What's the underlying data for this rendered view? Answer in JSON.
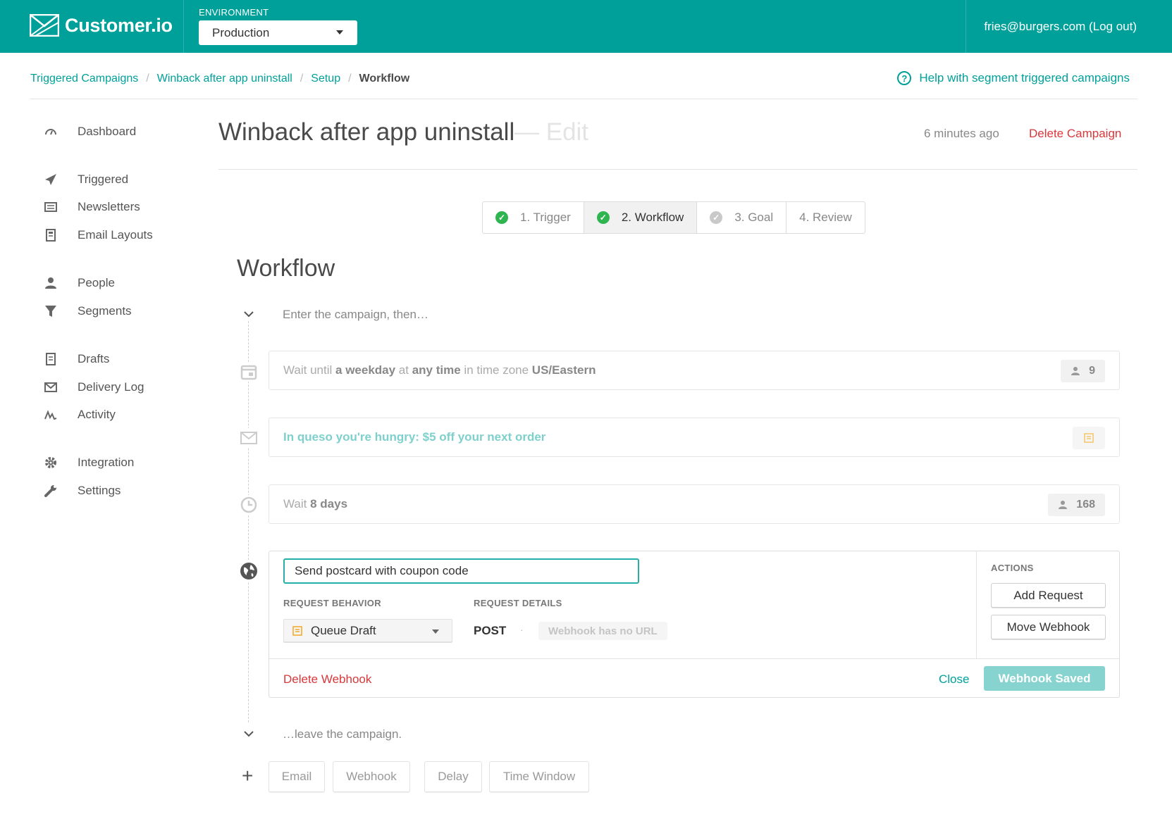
{
  "header": {
    "brand": "Customer.io",
    "environment_label": "ENVIRONMENT",
    "environment_value": "Production",
    "user": "fries@burgers.com (Log out)"
  },
  "breadcrumb": {
    "items": [
      "Triggered Campaigns",
      "Winback after app uninstall",
      "Setup"
    ],
    "current": "Workflow",
    "separator": "/"
  },
  "help": {
    "label": "Help with segment triggered campaigns"
  },
  "sidebar": {
    "items": [
      {
        "label": "Dashboard",
        "icon": "dashboard-icon"
      },
      {
        "label": "Triggered",
        "icon": "paper-plane-icon"
      },
      {
        "label": "Newsletters",
        "icon": "newspaper-icon"
      },
      {
        "label": "Email Layouts",
        "icon": "layout-icon"
      },
      {
        "label": "People",
        "icon": "person-icon"
      },
      {
        "label": "Segments",
        "icon": "funnel-icon"
      },
      {
        "label": "Drafts",
        "icon": "document-icon"
      },
      {
        "label": "Delivery Log",
        "icon": "envelope-icon"
      },
      {
        "label": "Activity",
        "icon": "activity-icon"
      },
      {
        "label": "Integration",
        "icon": "gear-icon"
      },
      {
        "label": "Settings",
        "icon": "wrench-icon"
      }
    ]
  },
  "campaign": {
    "title": "Winback after app uninstall",
    "title_suffix": "— Edit",
    "updated": "6 minutes ago",
    "delete_label": "Delete Campaign"
  },
  "steps": [
    {
      "label": "1. Trigger",
      "status": "complete"
    },
    {
      "label": "2. Workflow",
      "status": "complete"
    },
    {
      "label": "3. Goal",
      "status": "pending"
    },
    {
      "label": "4. Review",
      "status": "none"
    }
  ],
  "workflow": {
    "heading": "Workflow",
    "enter_text": "Enter the campaign, then…",
    "leave_text": "…leave the campaign.",
    "wait_weekday": {
      "prefix": "Wait until ",
      "day": "a weekday",
      "mid1": " at ",
      "time": "any time",
      "mid2": " in time zone ",
      "tz": "US/Eastern",
      "count": "9"
    },
    "email": {
      "subject": "In queso you're hungry: $5 off your next order"
    },
    "wait_days": {
      "prefix": "Wait ",
      "duration": "8 days",
      "count": "168"
    },
    "webhook": {
      "name_value": "Send postcard with coupon code",
      "request_behavior_label": "REQUEST BEHAVIOR",
      "request_details_label": "REQUEST DETAILS",
      "behavior_value": "Queue Draft",
      "method": "POST",
      "dot": "·",
      "url_placeholder": "Webhook has no URL",
      "actions_label": "ACTIONS",
      "add_request": "Add Request",
      "move_webhook": "Move Webhook",
      "delete_label": "Delete Webhook",
      "close_label": "Close",
      "saved_label": "Webhook Saved"
    },
    "add_buttons": [
      "Email",
      "Webhook",
      "Delay",
      "Time Window"
    ],
    "add_symbol": "+"
  },
  "colors": {
    "brand": "#00a09a",
    "danger": "#d9373a",
    "success": "#2fb550"
  }
}
